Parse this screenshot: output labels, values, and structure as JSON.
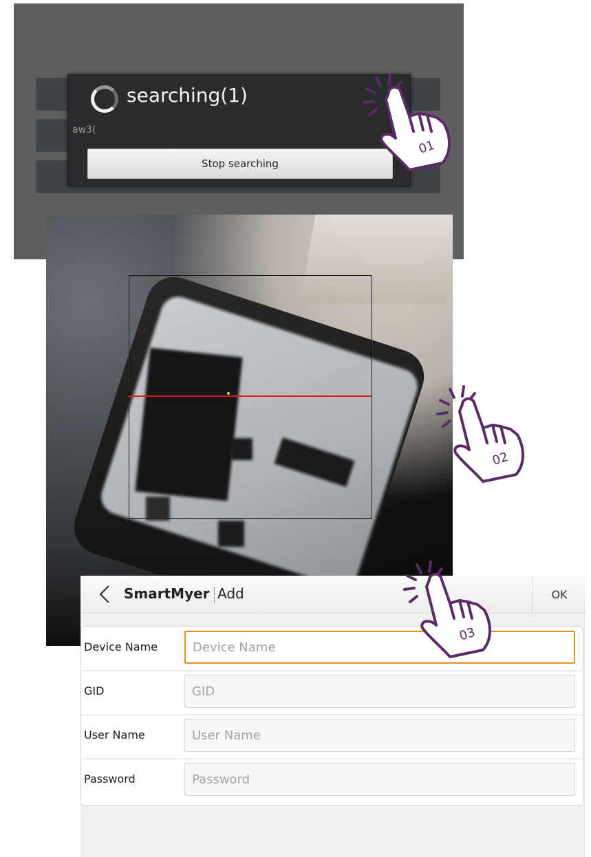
{
  "search_dialog": {
    "title": "searching(1)",
    "found_device": "aw3(",
    "stop_button": "Stop searching"
  },
  "scanner": {
    "scan_line_color": "#e01818"
  },
  "add_form": {
    "back_icon": "chevron-left-icon",
    "brand": "SmartMyer",
    "title": "Add",
    "ok_label": "OK",
    "fields": [
      {
        "label": "Device Name",
        "placeholder": "Device Name"
      },
      {
        "label": "GID",
        "placeholder": "GID"
      },
      {
        "label": "User Name",
        "placeholder": "User Name"
      },
      {
        "label": "Password",
        "placeholder": "Password"
      }
    ],
    "focus_color": "#e8901b"
  },
  "steps": [
    {
      "number": "01",
      "icon": "tap-hand-icon"
    },
    {
      "number": "02",
      "icon": "tap-hand-icon"
    },
    {
      "number": "03",
      "icon": "tap-hand-icon"
    }
  ],
  "accent_color": "#5b2a67"
}
